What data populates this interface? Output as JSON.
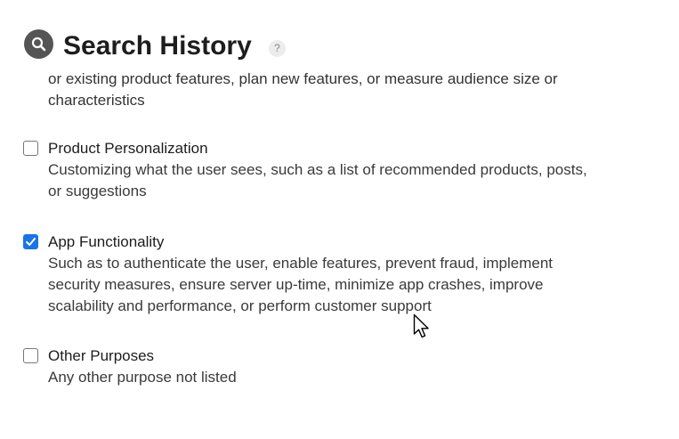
{
  "header": {
    "title": "Search History",
    "help_glyph": "?",
    "icon": "magnifier-icon"
  },
  "clipped_description": {
    "lines": [
      "or existing product features, plan new features, or measure audience size or",
      "characteristics"
    ]
  },
  "options": [
    {
      "title": "Product Personalization",
      "checked": false,
      "lines": [
        "Customizing what the user sees, such as a list of recommended products, posts,",
        "or suggestions"
      ]
    },
    {
      "title": "App Functionality",
      "checked": true,
      "lines": [
        "Such as to authenticate the user, enable features, prevent fraud, implement",
        "security measures, ensure server up-time, minimize app crashes, improve",
        "scalability and performance, or perform customer support"
      ]
    },
    {
      "title": "Other Purposes",
      "checked": false,
      "lines": [
        "Any other purpose not listed"
      ]
    }
  ],
  "colors": {
    "checkbox_checked": "#1a73e8",
    "header_icon_bg": "#555555"
  }
}
